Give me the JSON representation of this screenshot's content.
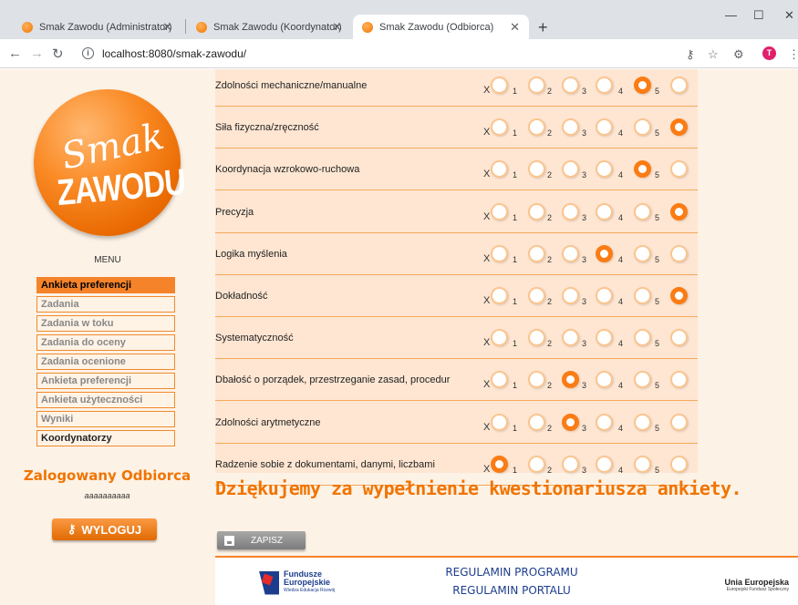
{
  "browser": {
    "tabs": [
      {
        "title": "Smak Zawodu (Administrator)",
        "active": false
      },
      {
        "title": "Smak Zawodu (Koordynator)",
        "active": false
      },
      {
        "title": "Smak Zawodu (Odbiorca)",
        "active": true
      }
    ],
    "url": "localhost:8080/smak-zawodu/",
    "profile_initial": "T"
  },
  "logo": {
    "line1": "Smak",
    "line2": "ZAWODU"
  },
  "menu": {
    "title": "MENU",
    "items": [
      {
        "label": "Ankieta preferencji",
        "state": "selected"
      },
      {
        "label": "Zadania",
        "state": "normal"
      },
      {
        "label": "Zadania w toku",
        "state": "normal"
      },
      {
        "label": "Zadania do oceny",
        "state": "normal"
      },
      {
        "label": "Zadania ocenione",
        "state": "normal"
      },
      {
        "label": "Ankieta preferencji",
        "state": "normal"
      },
      {
        "label": "Ankieta użyteczności",
        "state": "normal"
      },
      {
        "label": "Wyniki",
        "state": "normal"
      },
      {
        "label": "Koordynatorzy",
        "state": "dark"
      }
    ]
  },
  "user": {
    "role_label": "Zalogowany Odbiorca",
    "username": "aaaaaaaaaa",
    "logout_label": "WYLOGUJ"
  },
  "questionnaire": {
    "option_x": "X",
    "option_numbers": [
      "1",
      "2",
      "3",
      "4",
      "5"
    ],
    "rows": [
      {
        "label": "Zdolności mechaniczne/manualne",
        "selected": 4
      },
      {
        "label": "Siła fizyczna/zręczność",
        "selected": 5
      },
      {
        "label": "Koordynacja wzrokowo-ruchowa",
        "selected": 4
      },
      {
        "label": "Precyzja",
        "selected": 5
      },
      {
        "label": "Logika myślenia",
        "selected": 3
      },
      {
        "label": "Dokładność",
        "selected": 5
      },
      {
        "label": "Systematyczność",
        "selected": null
      },
      {
        "label": "Dbałość o porządek, przestrzeganie zasad, procedur",
        "selected": 2
      },
      {
        "label": "Zdolności arytmetyczne",
        "selected": 2
      },
      {
        "label": "Radzenie sobie z dokumentami, danymi, liczbami",
        "selected": 0
      }
    ],
    "thanks": "Dziękujemy za wypełnienie kwestionariusza ankiety.",
    "save_label": "ZAPISZ"
  },
  "footer": {
    "fe_line1": "Fundusze",
    "fe_line2": "Europejskie",
    "fe_sub": "Wiedza Edukacja Rozwój",
    "link1": "REGULAMIN PROGRAMU",
    "link2": "REGULAMIN PORTALU",
    "eu_title": "Unia Europejska",
    "eu_sub": "Europejski Fundusz Społeczny"
  },
  "colors": {
    "accent": "#f5832a",
    "panel": "#fee6d2",
    "page": "#fdf2e6",
    "link": "#1c3d8c"
  }
}
